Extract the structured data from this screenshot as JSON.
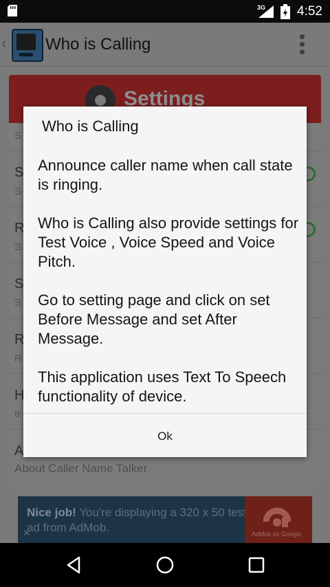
{
  "status_bar": {
    "time": "4:52",
    "network": "3G"
  },
  "app_bar": {
    "title": "Who is Calling"
  },
  "background": {
    "settings_label": "Settings",
    "rows": [
      {
        "title": "S",
        "subtitle": "S"
      },
      {
        "title": "S",
        "subtitle": "S"
      },
      {
        "title": "R",
        "subtitle": "S"
      },
      {
        "title": "S",
        "subtitle": "S"
      },
      {
        "title": "R",
        "subtitle": "R"
      },
      {
        "title": "H",
        "subtitle": "tr"
      },
      {
        "title": "A",
        "subtitle": ""
      }
    ],
    "about_subtitle": "About Caller Name Talker"
  },
  "ad": {
    "bold": "Nice job!",
    "text": "You're displaying a 320 x 50 test ad from AdMob.",
    "close": "✕",
    "logo_caption": "AdMob by Google"
  },
  "dialog": {
    "title": "Who is Calling",
    "paragraphs": [
      "Announce caller name when call state is ringing.",
      "Who is Calling also provide settings for Test Voice , Voice Speed and Voice Pitch.",
      "Go to setting page and click on set Before Message and set After Message.",
      "This application uses Text To Speech functionality of device."
    ],
    "ok_label": "Ok"
  }
}
